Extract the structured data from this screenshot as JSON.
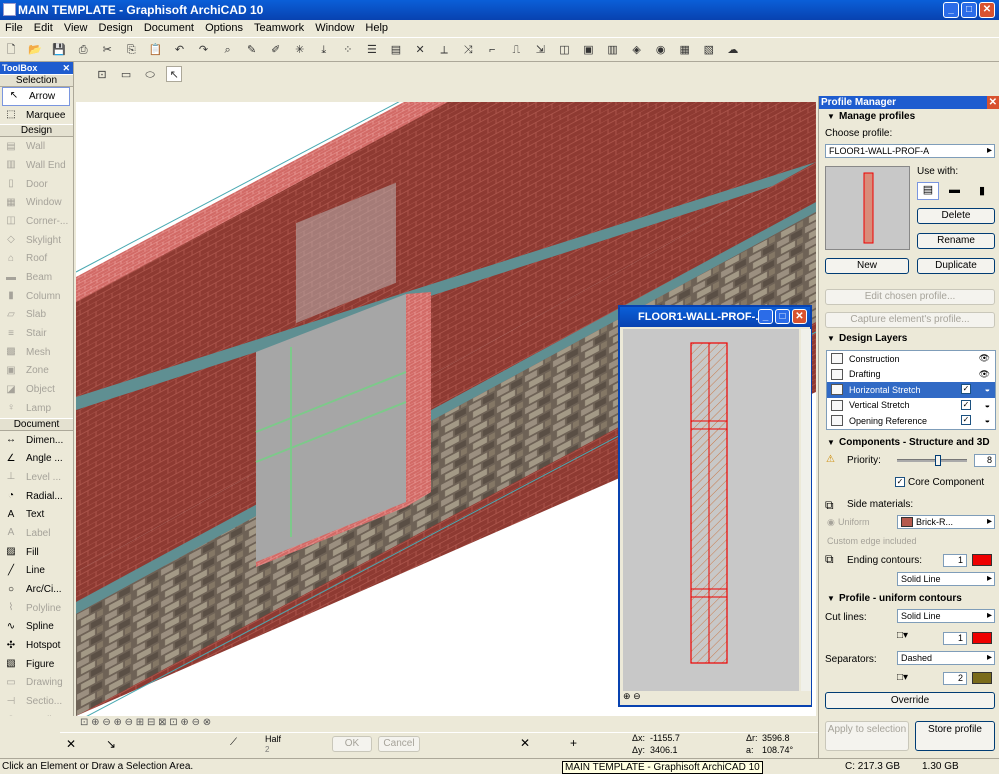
{
  "window": {
    "title": "MAIN TEMPLATE - Graphisoft ArchiCAD 10",
    "minimize": "_",
    "maximize": "□",
    "close": "✕"
  },
  "menu": [
    "File",
    "Edit",
    "View",
    "Design",
    "Document",
    "Options",
    "Teamwork",
    "Window",
    "Help"
  ],
  "toolbox": {
    "title": "ToolBox",
    "close": "✕",
    "sections": {
      "selection": "Selection",
      "design": "Design",
      "document": "Document"
    },
    "selection_tools": [
      {
        "label": "Arrow",
        "icon": "arrow-icon",
        "glyph": "↖",
        "state": "selected"
      },
      {
        "label": "Marquee",
        "icon": "marquee-icon",
        "glyph": "⬚",
        "state": "enabled"
      }
    ],
    "design_tools": [
      {
        "label": "Wall",
        "icon": "wall-icon",
        "glyph": "▤"
      },
      {
        "label": "Wall End",
        "icon": "wall-end-icon",
        "glyph": "▥"
      },
      {
        "label": "Door",
        "icon": "door-icon",
        "glyph": "▯"
      },
      {
        "label": "Window",
        "icon": "window-icon",
        "glyph": "▦"
      },
      {
        "label": "Corner-...",
        "icon": "corner-window-icon",
        "glyph": "◫"
      },
      {
        "label": "Skylight",
        "icon": "skylight-icon",
        "glyph": "◇"
      },
      {
        "label": "Roof",
        "icon": "roof-icon",
        "glyph": "⌂"
      },
      {
        "label": "Beam",
        "icon": "beam-icon",
        "glyph": "▬"
      },
      {
        "label": "Column",
        "icon": "column-icon",
        "glyph": "▮"
      },
      {
        "label": "Slab",
        "icon": "slab-icon",
        "glyph": "▱"
      },
      {
        "label": "Stair",
        "icon": "stair-icon",
        "glyph": "≡"
      },
      {
        "label": "Mesh",
        "icon": "mesh-icon",
        "glyph": "▩"
      },
      {
        "label": "Zone",
        "icon": "zone-icon",
        "glyph": "▣"
      },
      {
        "label": "Object",
        "icon": "object-icon",
        "glyph": "◪"
      },
      {
        "label": "Lamp",
        "icon": "lamp-icon",
        "glyph": "♀"
      }
    ],
    "document_tools": [
      {
        "label": "Dimen...",
        "icon": "dimension-icon",
        "glyph": "↔",
        "enabled": true
      },
      {
        "label": "Angle ...",
        "icon": "angle-dimension-icon",
        "glyph": "∠",
        "enabled": true
      },
      {
        "label": "Level ...",
        "icon": "level-dimension-icon",
        "glyph": "⊥",
        "enabled": false
      },
      {
        "label": "Radial...",
        "icon": "radial-dimension-icon",
        "glyph": "◔",
        "enabled": true
      },
      {
        "label": "Text",
        "icon": "text-icon",
        "glyph": "A",
        "enabled": true
      },
      {
        "label": "Label",
        "icon": "label-icon",
        "glyph": "A",
        "enabled": false
      },
      {
        "label": "Fill",
        "icon": "fill-icon",
        "glyph": "▨",
        "enabled": true
      },
      {
        "label": "Line",
        "icon": "line-icon",
        "glyph": "╱",
        "enabled": true
      },
      {
        "label": "Arc/Ci...",
        "icon": "arc-icon",
        "glyph": "○",
        "enabled": true
      },
      {
        "label": "Polyline",
        "icon": "polyline-icon",
        "glyph": "⌇",
        "enabled": false
      },
      {
        "label": "Spline",
        "icon": "spline-icon",
        "glyph": "∿",
        "enabled": true
      },
      {
        "label": "Hotspot",
        "icon": "hotspot-icon",
        "glyph": "✣",
        "enabled": true
      },
      {
        "label": "Figure",
        "icon": "figure-icon",
        "glyph": "▧",
        "enabled": true
      },
      {
        "label": "Drawing",
        "icon": "drawing-icon",
        "glyph": "▭",
        "enabled": false
      },
      {
        "label": "Sectio...",
        "icon": "section-icon",
        "glyph": "⊣",
        "enabled": false
      },
      {
        "label": "Detail",
        "icon": "detail-icon",
        "glyph": "⊙",
        "enabled": false
      }
    ]
  },
  "profile_window": {
    "title": "FLOOR1-WALL-PROF-...",
    "minimize": "_",
    "maximize": "□",
    "close": "✕"
  },
  "bottom_bar": {
    "half_label": "Half",
    "half_sub": "2",
    "ok": "OK",
    "cancel": "Cancel",
    "dx_label": "Δx:",
    "dx": "-1155.7",
    "dy_label": "Δy:",
    "dy": "3406.1",
    "dr_label": "Δr:",
    "dr": "3596.8",
    "da_label": "a:",
    "da": "108.74°"
  },
  "status": {
    "message": "Click an Element or Draw a Selection Area.",
    "taskbar_tooltip": "MAIN TEMPLATE - Graphisoft ArchiCAD 10",
    "disk_c": "C: 217.3 GB",
    "disk_other": "1.30 GB"
  },
  "profile_manager": {
    "title": "Profile Manager",
    "close": "✕",
    "manage_header": "Manage profiles",
    "choose_label": "Choose profile:",
    "chosen_profile": "FLOOR1-WALL-PROF-A",
    "use_with_label": "Use with:",
    "delete": "Delete",
    "rename": "Rename",
    "new": "New",
    "duplicate": "Duplicate",
    "edit_chosen": "Edit chosen profile...",
    "capture": "Capture element's profile...",
    "design_layers_header": "Design Layers",
    "layers": [
      {
        "name": "Construction",
        "checked": "",
        "eye": "👁",
        "selected": false,
        "has_check": false
      },
      {
        "name": "Drafting",
        "checked": "",
        "eye": "👁",
        "selected": false,
        "has_check": false
      },
      {
        "name": "Horizontal Stretch",
        "checked": "✓",
        "eye": "◒",
        "selected": true,
        "has_check": true
      },
      {
        "name": "Vertical Stretch",
        "checked": "✓",
        "eye": "◒",
        "selected": false,
        "has_check": true
      },
      {
        "name": "Opening Reference",
        "checked": "✓",
        "eye": "◒",
        "selected": false,
        "has_check": true
      }
    ],
    "components_header": "Components - Structure and 3D",
    "priority_label": "Priority:",
    "priority_value": "8",
    "priority_level": 0.6,
    "core_component_label": "Core Component",
    "core_component_checked": "✓",
    "side_materials_label": "Side materials:",
    "uniform_label": "Uniform",
    "material_name": "Brick-R...",
    "material_color": "#b55a4e",
    "custom_edge_label": "Custom edge included",
    "ending_contours_label": "Ending contours:",
    "ending_pen": "1",
    "ending_line": "Solid Line",
    "profile_header": "Profile - uniform contours",
    "cut_lines_label": "Cut lines:",
    "cut_line_type": "Solid Line",
    "cut_pen": "1",
    "separators_label": "Separators:",
    "separator_type": "Dashed",
    "separator_pen": "2",
    "override": "Override",
    "apply": "Apply to selection",
    "store": "Store profile"
  }
}
